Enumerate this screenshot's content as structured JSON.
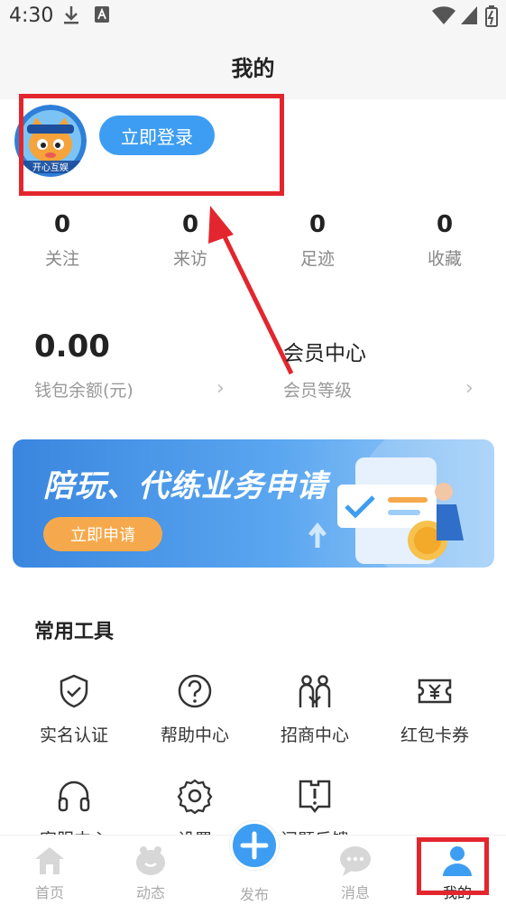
{
  "status": {
    "time": "4:30",
    "icons": [
      "download-icon",
      "a-box-icon",
      "wifi-icon",
      "signal-icon",
      "battery-icon"
    ]
  },
  "header": {
    "title": "我的"
  },
  "profile": {
    "login_label": "立即登录",
    "avatar_text": "开心互娱"
  },
  "stats": [
    {
      "value": "0",
      "label": "关注"
    },
    {
      "value": "0",
      "label": "来访"
    },
    {
      "value": "0",
      "label": "足迹"
    },
    {
      "value": "0",
      "label": "收藏"
    }
  ],
  "wallet": {
    "amount": "0.00",
    "label": "钱包余额(元)"
  },
  "member": {
    "title": "会员中心",
    "label": "会员等级"
  },
  "banner": {
    "title": "陪玩、代练业务申请",
    "button": "立即申请"
  },
  "tools": {
    "section_title": "常用工具",
    "items": [
      {
        "label": "实名认证",
        "icon": "shield-check-icon"
      },
      {
        "label": "帮助中心",
        "icon": "help-circle-icon"
      },
      {
        "label": "招商中心",
        "icon": "people-icon"
      },
      {
        "label": "红包卡券",
        "icon": "coupon-icon"
      },
      {
        "label": "客服中心",
        "icon": "headset-icon"
      },
      {
        "label": "设置",
        "icon": "gear-icon"
      },
      {
        "label": "问题反馈",
        "icon": "feedback-icon"
      }
    ]
  },
  "tabbar": {
    "items": [
      {
        "label": "首页",
        "icon": "home-icon"
      },
      {
        "label": "动态",
        "icon": "dynamic-icon"
      },
      {
        "label": "发布",
        "icon": "plus-icon"
      },
      {
        "label": "消息",
        "icon": "message-icon"
      },
      {
        "label": "我的",
        "icon": "user-icon"
      }
    ]
  },
  "colors": {
    "accent": "#3d9df2",
    "highlight": "#e3262e",
    "banner_button": "#f6a94c"
  }
}
